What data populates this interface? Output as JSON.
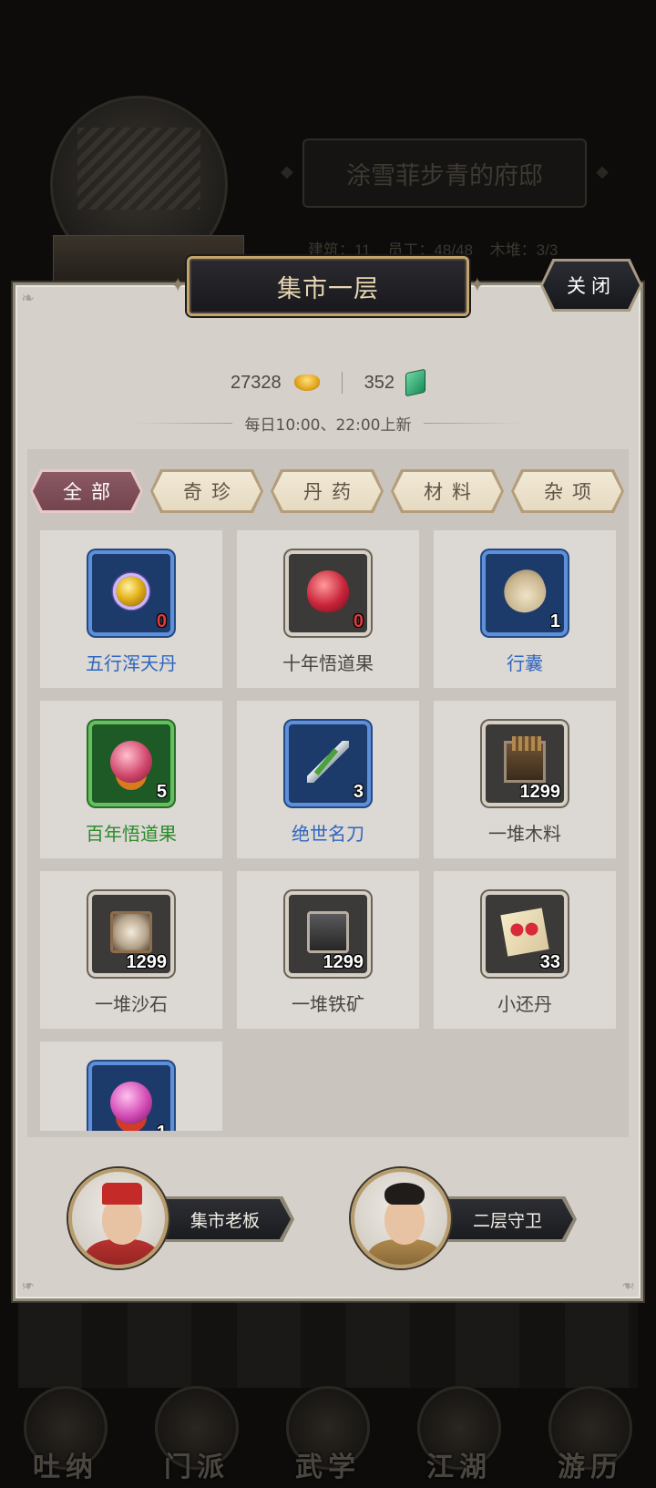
{
  "background": {
    "mansion_title": "涂雪菲步青的府邸",
    "stats_line": [
      "建筑：11",
      "员工：48/48",
      "木堆：3/3"
    ],
    "bottom_nav": [
      "吐纳",
      "门派",
      "武学",
      "江湖",
      "游历"
    ]
  },
  "dialog": {
    "title": "集市一层",
    "close_label": "关闭",
    "currency": {
      "gold": "27328",
      "jade": "352"
    },
    "refresh_note": "每日10:00、22:00上新"
  },
  "tabs": [
    {
      "label": "全部",
      "active": true
    },
    {
      "label": "奇珍",
      "active": false
    },
    {
      "label": "丹药",
      "active": false
    },
    {
      "label": "材料",
      "active": false
    },
    {
      "label": "杂项",
      "active": false
    }
  ],
  "items": [
    {
      "name": "五行浑天丹",
      "count": "0",
      "rarity": "blue",
      "icon": "golden-pill-icon",
      "count_color": "red"
    },
    {
      "name": "十年悟道果",
      "count": "0",
      "rarity": "gray",
      "icon": "red-fruit-icon",
      "count_color": "red"
    },
    {
      "name": "行囊",
      "count": "1",
      "rarity": "blue",
      "icon": "pouch-icon",
      "count_color": "white"
    },
    {
      "name": "百年悟道果",
      "count": "5",
      "rarity": "green",
      "icon": "pink-fruit-icon",
      "count_color": "white"
    },
    {
      "name": "绝世名刀",
      "count": "3",
      "rarity": "blue",
      "icon": "blade-icon",
      "count_color": "white"
    },
    {
      "name": "一堆木料",
      "count": "1299",
      "rarity": "gray",
      "icon": "wood-crate-icon",
      "count_color": "white"
    },
    {
      "name": "一堆沙石",
      "count": "1299",
      "rarity": "gray",
      "icon": "sand-crate-icon",
      "count_color": "white"
    },
    {
      "name": "一堆铁矿",
      "count": "1299",
      "rarity": "gray",
      "icon": "ore-cart-icon",
      "count_color": "white"
    },
    {
      "name": "小还丹",
      "count": "33",
      "rarity": "gray",
      "icon": "red-pills-icon",
      "count_color": "white"
    },
    {
      "name": "",
      "count": "1",
      "rarity": "blue",
      "icon": "pink-orb-icon",
      "count_color": "white"
    }
  ],
  "npcs": [
    {
      "label": "集市老板"
    },
    {
      "label": "二层守卫"
    }
  ]
}
